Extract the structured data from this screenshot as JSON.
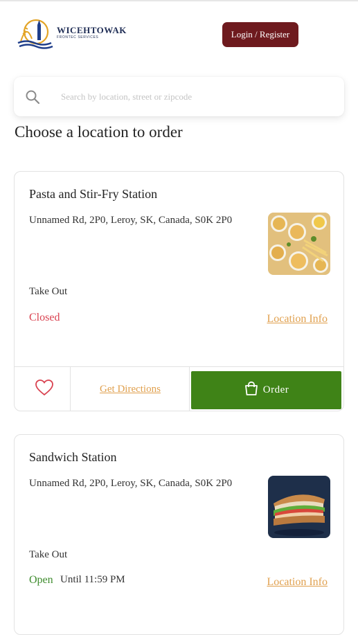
{
  "header": {
    "brand_name": "WICEHTOWAK",
    "brand_tagline": "FRONTEC SERVICES",
    "login_label": "Login / Register"
  },
  "search": {
    "placeholder": "Search by location, street or zipcode",
    "value": ""
  },
  "section_title": "Choose a location to order",
  "locations": [
    {
      "name": "Pasta and Stir-Fry Station",
      "address": "Unnamed Rd, 2P0, Leroy, SK, Canada, S0K 2P0",
      "mode": "Take Out",
      "status": "Closed",
      "location_info_label": "Location Info",
      "directions_label": "Get Directions",
      "order_label": "Order",
      "favorite": false
    },
    {
      "name": "Sandwich Station",
      "address": "Unnamed Rd, 2P0, Leroy, SK, Canada, S0K 2P0",
      "mode": "Take Out",
      "status": "Open",
      "hours": "Until 11:59 PM",
      "location_info_label": "Location Info"
    }
  ],
  "colors": {
    "login_bg": "#6e1a1e",
    "order_bg": "#3f8317",
    "link": "#e0a04e",
    "closed": "#d9414f",
    "open": "#3f8c2e"
  }
}
